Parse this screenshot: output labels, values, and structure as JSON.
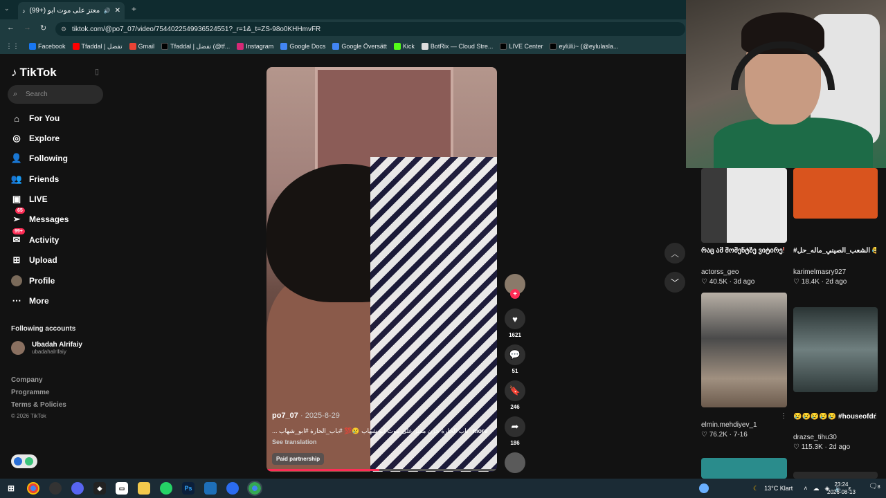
{
  "browser": {
    "tab_title": "(99+) حزن معتز على موت ابو",
    "url": "tiktok.com/@po7_07/video/7544022549936524551?_r=1&_t=ZS-98o0KHHmvFR",
    "bookmarks": [
      {
        "label": "Facebook",
        "color": "#1877f2"
      },
      {
        "label": "Tfaddal | تفضل",
        "color": "#ff0000"
      },
      {
        "label": "Gmail",
        "color": "#ea4335"
      },
      {
        "label": "Tfaddal | تفضل (@tf...",
        "color": "#111111"
      },
      {
        "label": "Instagram",
        "color": "#d62976"
      },
      {
        "label": "Google Docs",
        "color": "#4285f4"
      },
      {
        "label": "Google Översätt",
        "color": "#4285f4"
      },
      {
        "label": "Kick",
        "color": "#53fc18"
      },
      {
        "label": "BotRix — Cloud Stre...",
        "color": "#dddddd"
      },
      {
        "label": "LIVE Center",
        "color": "#111111"
      },
      {
        "label": "eylülü~ (@eylulasla...",
        "color": "#111111"
      }
    ]
  },
  "sidebar": {
    "logo": "TikTok",
    "search_placeholder": "Search",
    "nav": [
      {
        "label": "For You",
        "icon": "home-icon"
      },
      {
        "label": "Explore",
        "icon": "compass-icon"
      },
      {
        "label": "Following",
        "icon": "user-follow-icon"
      },
      {
        "label": "Friends",
        "icon": "friends-icon"
      },
      {
        "label": "LIVE",
        "icon": "live-icon"
      },
      {
        "label": "Messages",
        "icon": "messages-icon",
        "badge": "65"
      },
      {
        "label": "Activity",
        "icon": "activity-icon",
        "badge": "99+"
      },
      {
        "label": "Upload",
        "icon": "upload-icon"
      },
      {
        "label": "Profile",
        "icon": "profile-icon"
      },
      {
        "label": "More",
        "icon": "more-icon"
      }
    ],
    "following_header": "Following accounts",
    "following": [
      {
        "name": "Ubadah Alrifaiy",
        "handle": "ubadahalrifaiy"
      }
    ],
    "footer": [
      "Company",
      "Programme",
      "Terms & Policies",
      "© 2026 TikTok"
    ]
  },
  "video": {
    "username": "po7_07",
    "date": " · 2025-8-29",
    "caption": "باب الحارة حزن معتز على موت ابو شهاب 😢💯 #باب_الحارة #ابو_شهاب ...",
    "more": "more",
    "see_translation": "See translation",
    "paid_partnership": "Paid partnership",
    "progress": 0.49
  },
  "actions": {
    "likes": "1621",
    "comments": "51",
    "saves": "246",
    "shares": "186"
  },
  "recommended": [
    {
      "title": "რაც ამ მომენტზე ვიტირე❤️ 🩹 #cukur...",
      "user": "actorss_geo",
      "likes": "40.5K",
      "age": "3d ago",
      "color": "#d9d9d9"
    },
    {
      "title": "#الشعب_الصيني_ماله_حل 😂😂 ...",
      "user": "karimelmasry927",
      "likes": "18.4K",
      "age": "2d ago",
      "color": "#d9541e"
    },
    {
      "title": "",
      "user": "elmin.mehdiyev_1",
      "likes": "76.2K",
      "age": "7-16",
      "color": "#8d7d6f"
    },
    {
      "title": "😢😢😢😢😢 #houseofdragons...",
      "user": "drazse_tihu30",
      "likes": "115.3K",
      "age": "2d ago",
      "color": "#5a6a6a"
    }
  ],
  "taskbar": {
    "weather": "13°C  Klart",
    "time": "23:24",
    "date": "2026-08-13",
    "lang": "ε",
    "notifications": "8"
  }
}
